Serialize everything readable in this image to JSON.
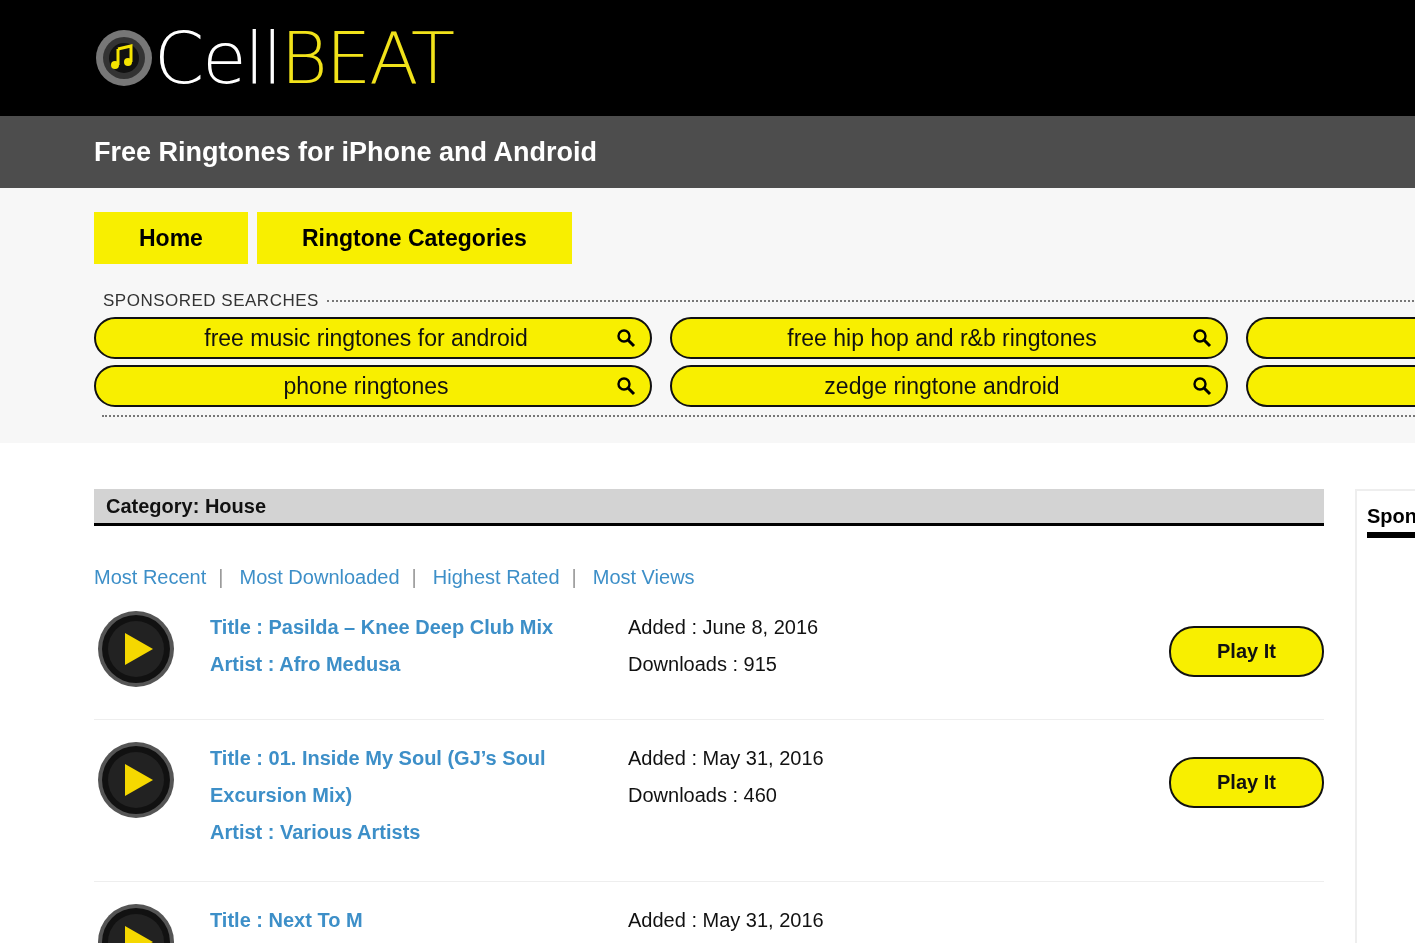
{
  "logo": {
    "part_1": "Cell",
    "part_2": "BEAT"
  },
  "tagline": "Free Ringtones for iPhone and Android",
  "nav": [
    {
      "label": "Home"
    },
    {
      "label": "Ringtone Categories"
    }
  ],
  "sponsored": {
    "heading": "SPONSORED SEARCHES",
    "rows": [
      [
        {
          "query": "free music ringtones for android"
        },
        {
          "query": "free hip hop and r&b ringtones"
        },
        {
          "cut": true
        }
      ],
      [
        {
          "query": "phone ringtones"
        },
        {
          "query": "zedge ringtone android"
        },
        {
          "cut": true
        }
      ]
    ]
  },
  "category": "Category: House",
  "sort_links": [
    {
      "label": "Most Recent"
    },
    {
      "label": "Most Downloaded"
    },
    {
      "label": "Highest Rated"
    },
    {
      "label": "Most Views"
    }
  ],
  "separator": "|",
  "ringtones": [
    {
      "title": "Title : Pasilda – Knee Deep Club Mix",
      "artist": "Artist : Afro Medusa",
      "added": "Added : June 8, 2016",
      "downloads": "Downloads : 915",
      "button": "Play It"
    },
    {
      "title": "Title : 01. Inside My Soul (GJ’s Soul Excursion Mix)",
      "artist": "Artist : Various Artists",
      "added": "Added : May 31, 2016",
      "downloads": "Downloads : 460",
      "button": "Play It"
    },
    {
      "title": "Title : Next To M",
      "added": "Added : May 31, 2016"
    }
  ],
  "sidebar": {
    "heading": "Spon"
  }
}
